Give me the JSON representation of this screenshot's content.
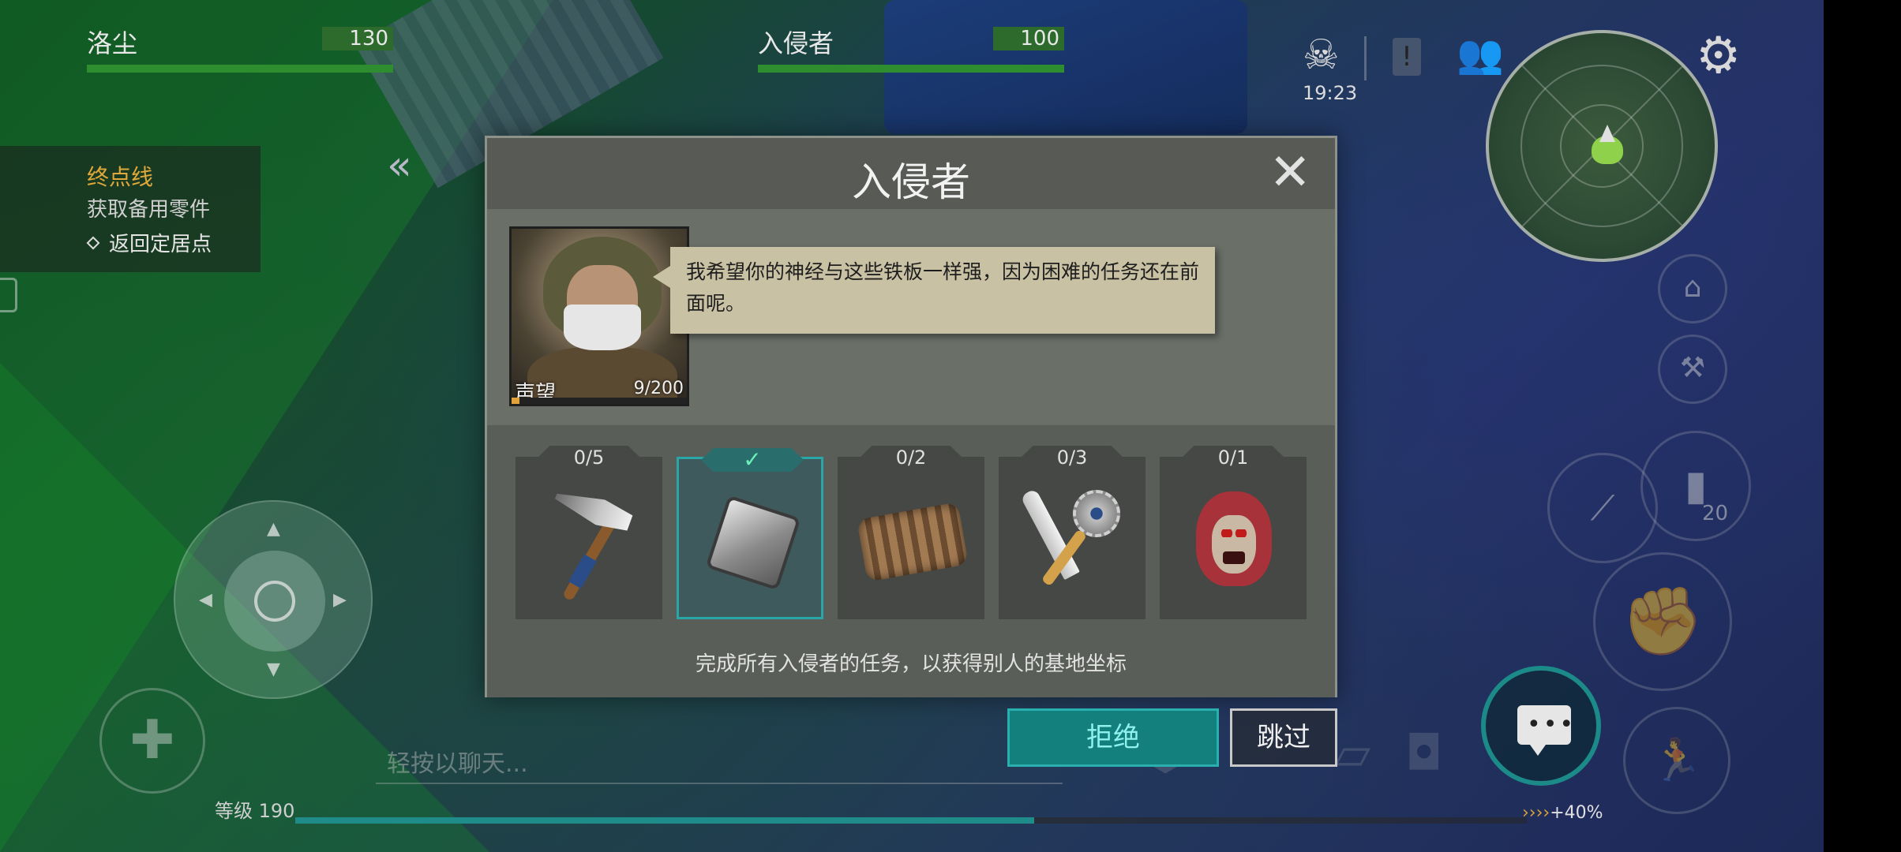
{
  "party": [
    {
      "name": "洛尘",
      "level": "130",
      "hp": 1.0
    },
    {
      "name": "入侵者",
      "level": "100",
      "hp": 1.0
    }
  ],
  "hud": {
    "timer": "19:23",
    "icons": {
      "skull": "skull-icon",
      "alert": "alert-icon",
      "friends": "friends-icon",
      "settings": "gear-icon"
    }
  },
  "quest": {
    "title": "终点线",
    "subtitle": "获取备用零件",
    "step": "返回定居点"
  },
  "dialog": {
    "title": "入侵者",
    "speech": "我希望你的神经与这些铁板一样强，因为困难的任务还在前面呢。",
    "reputation": {
      "label": "声望",
      "value": "9/200",
      "fraction": 0.045
    },
    "tasks": [
      {
        "icon": "axe-icon",
        "progress": "0/5",
        "done": false
      },
      {
        "icon": "metal-plate-icon",
        "progress": "✓",
        "done": true
      },
      {
        "icon": "engine-part-icon",
        "progress": "0/2",
        "done": false
      },
      {
        "icon": "machete-saw-icon",
        "progress": "0/3",
        "done": false
      },
      {
        "icon": "zombie-head-icon",
        "progress": "0/1",
        "done": false
      }
    ],
    "reward_text": "完成所有入侵者的任务，以获得别人的基地坐标",
    "refuse_label": "拒绝",
    "skip_label": "跳过"
  },
  "chat": {
    "placeholder": "轻按以聊天..."
  },
  "player": {
    "level_label": "等级 190",
    "xp_fraction": 0.6,
    "xp_bonus": "+40%",
    "xp_bonus_arrows": "››››"
  },
  "actions": {
    "consumable_count": "20"
  },
  "colors": {
    "accent_teal": "#1f8c8a",
    "hp_green": "#2d8d2f",
    "quest_gold": "#e0a83a",
    "speech_bg": "#c9c1a3"
  }
}
